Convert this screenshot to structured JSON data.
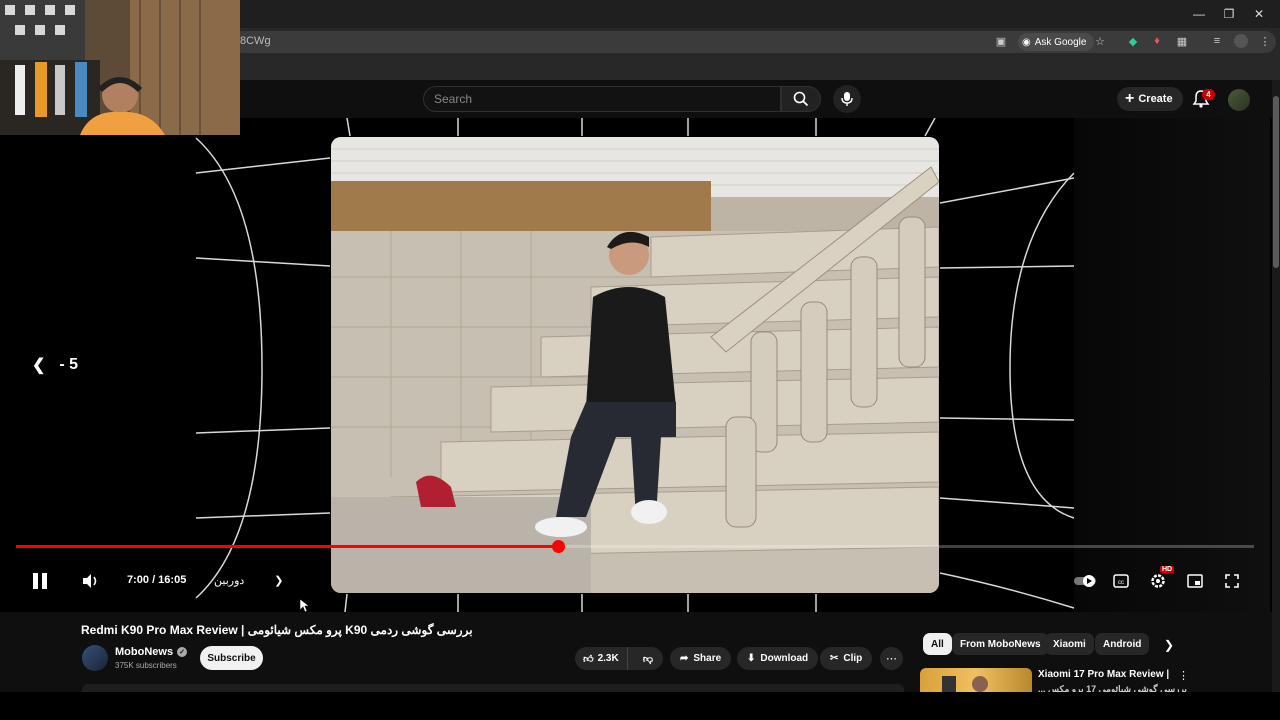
{
  "browser": {
    "address_text": "8CWg",
    "ask_google": "Ask Google",
    "window_controls": [
      "minimize-icon",
      "restore-icon",
      "close-icon"
    ]
  },
  "header": {
    "search_placeholder": "Search",
    "create_label": "Create",
    "notification_count": "4"
  },
  "player": {
    "chapter_back_label": "- 5",
    "time_text": "7:00 / 16:05",
    "chapter_title": "دوربین",
    "progress_fraction": 0.4375,
    "hd_badge": "HD",
    "accent_color": "#ff0000"
  },
  "video": {
    "title": "Redmi K90 Pro Max Review | پرو مکس شیائومی K90 بررسی گوشی ردمی",
    "channel_name": "MoboNews",
    "subscribers": "375K subscribers",
    "subscribe_label": "Subscribe",
    "like_count": "2.3K",
    "share_label": "Share",
    "download_label": "Download",
    "clip_label": "Clip"
  },
  "sidebar": {
    "chips": [
      "All",
      "From MoboNews",
      "Xiaomi",
      "Android"
    ],
    "recommendation_title_line1": "Xiaomi 17 Pro Max Review |",
    "recommendation_title_line2": "... بررسی گوشی شیائومی 17 پرو مکس"
  }
}
